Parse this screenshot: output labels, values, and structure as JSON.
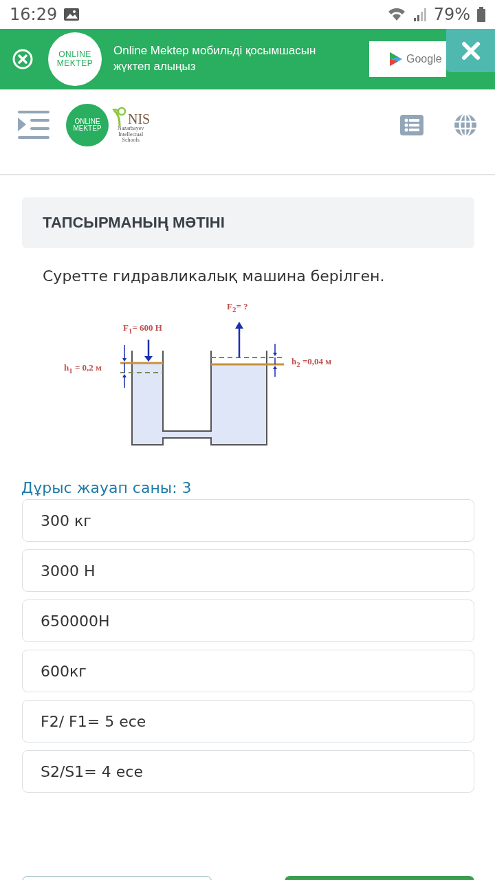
{
  "status_bar": {
    "time": "16:29",
    "battery": "79%"
  },
  "banner": {
    "logo": [
      "ONLINE",
      "MEKTEP"
    ],
    "message": "Online Mektep мобильді қосымшасын жүктеп алыңыз",
    "store_button": "Google"
  },
  "header": {
    "logo": [
      "ONLINE",
      "MEKTEP"
    ],
    "nis_logo": {
      "title": "NIS",
      "subtitle": [
        "Nazarbayev",
        "Intellectual",
        "Schools"
      ]
    }
  },
  "task": {
    "heading": "ТАПСЫРМАНЫҢ МӘТІНІ",
    "question": "Суретте гидравликалық машина берілген.",
    "figure_labels": {
      "f2": "F$_{2}$= ?",
      "f1": "F$_{1}$= 600 Н",
      "h1": "h$_{1}$ = 0,2 м",
      "h2": "h$_{2}$ =0,04 м"
    }
  },
  "answers_label": "Дұрыс жауап саны: 3",
  "answers": [
    {
      "text": "300 кг"
    },
    {
      "text": "3000 Н"
    },
    {
      "text": "650000Н"
    },
    {
      "text": "600кг"
    },
    {
      "text": "F2/ F1= 5 есе"
    },
    {
      "text": "S2/S1= 4 есе"
    }
  ]
}
